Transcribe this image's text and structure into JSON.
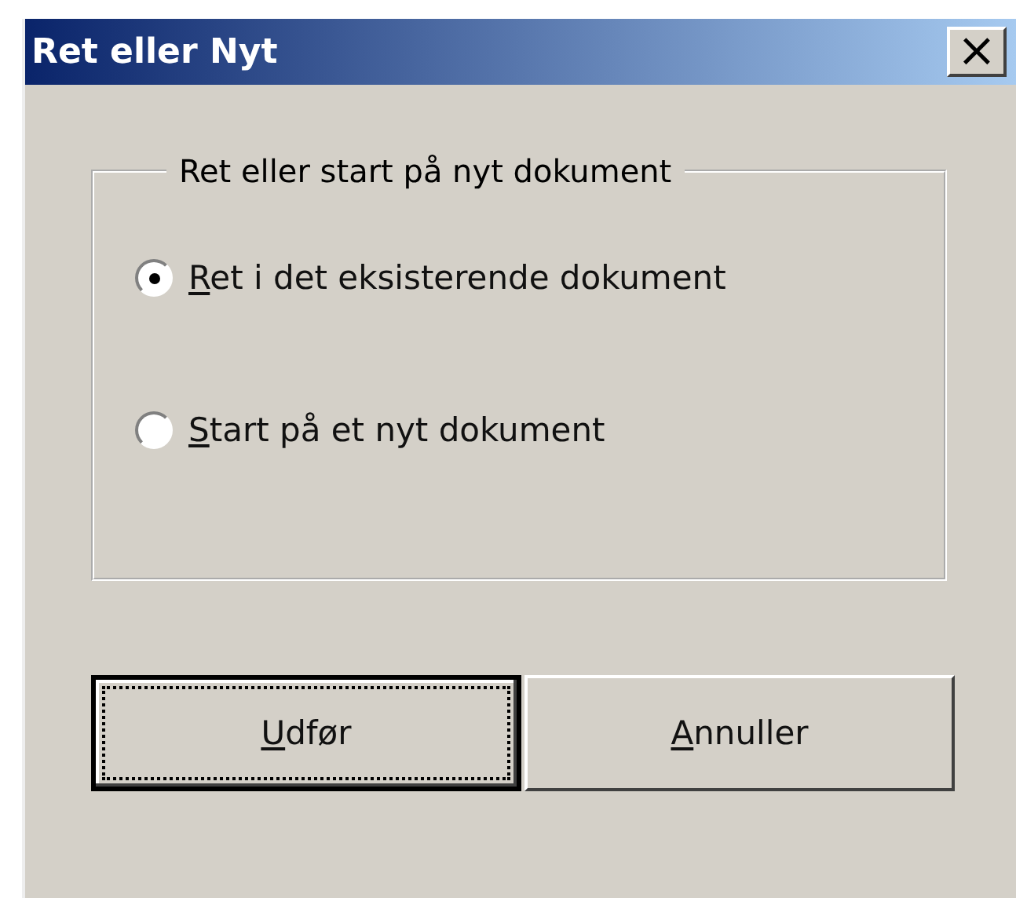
{
  "window": {
    "title": "Ret eller Nyt",
    "close": "×"
  },
  "group": {
    "label": "Ret eller start på nyt dokument",
    "options": [
      {
        "label": "Ret i det eksisterende dokument",
        "selected": true,
        "underline_first": true
      },
      {
        "label": "Start på et nyt dokument",
        "selected": false,
        "underline_first": true
      }
    ]
  },
  "buttons": [
    {
      "label": "Udfør",
      "default": true,
      "underline_first": true
    },
    {
      "label": "Annuller",
      "default": false,
      "underline_first": true
    }
  ]
}
